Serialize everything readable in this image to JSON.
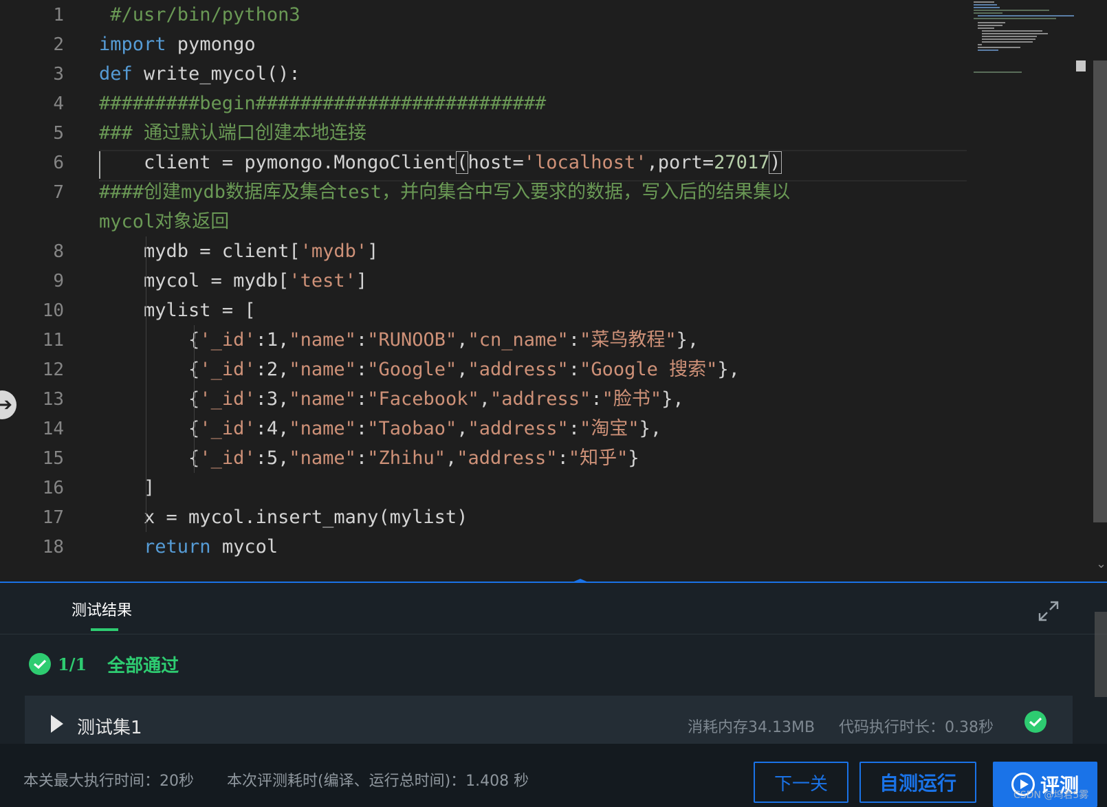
{
  "editor": {
    "line_numbers": [
      "1",
      "2",
      "3",
      "4",
      "5",
      "6",
      "7",
      "",
      "8",
      "9",
      "10",
      "11",
      "12",
      "13",
      "14",
      "15",
      "16",
      "17",
      "18"
    ],
    "lines": [
      {
        "n": 0,
        "tokens": [
          [
            "cm",
            " #/usr/bin/python3"
          ]
        ]
      },
      {
        "n": 1,
        "tokens": [
          [
            "kw",
            "import"
          ],
          [
            "",
            " pymongo"
          ]
        ]
      },
      {
        "n": 2,
        "tokens": [
          [
            "kw",
            "def"
          ],
          [
            "",
            " write_mycol():"
          ]
        ]
      },
      {
        "n": 3,
        "tokens": [
          [
            "cm",
            "#########begin##########################"
          ]
        ]
      },
      {
        "n": 4,
        "tokens": [
          [
            "cm",
            "### 通过默认端口创建本地连接"
          ]
        ]
      },
      {
        "n": 5,
        "tokens": [
          [
            "",
            "    client = pymongo.MongoClient"
          ],
          [
            "br",
            "("
          ],
          [
            "",
            "host="
          ],
          [
            "st",
            "'localhost'"
          ],
          [
            "",
            ",port="
          ],
          [
            "nm",
            "27017"
          ],
          [
            "br",
            ")"
          ]
        ]
      },
      {
        "n": 6,
        "tokens": [
          [
            "cm",
            "####创建mydb数据库及集合test，并向集合中写入要求的数据，写入后的结果集以"
          ]
        ]
      },
      {
        "n": 7,
        "tokens": [
          [
            "cm",
            "mycol对象返回"
          ]
        ]
      },
      {
        "n": 8,
        "tokens": [
          [
            "",
            "    mydb = client["
          ],
          [
            "st",
            "'mydb'"
          ],
          [
            "",
            "]"
          ]
        ]
      },
      {
        "n": 9,
        "tokens": [
          [
            "",
            "    mycol = mydb["
          ],
          [
            "st",
            "'test'"
          ],
          [
            "",
            "]"
          ]
        ]
      },
      {
        "n": 10,
        "tokens": [
          [
            "",
            "    mylist = ["
          ]
        ]
      },
      {
        "n": 11,
        "tokens": [
          [
            "",
            "        {"
          ],
          [
            "st",
            "'_id'"
          ],
          [
            "",
            ":1,"
          ],
          [
            "st",
            "\"name\""
          ],
          [
            "",
            ":"
          ],
          [
            "st",
            "\"RUNOOB\""
          ],
          [
            "",
            ","
          ],
          [
            "st",
            "\"cn_name\""
          ],
          [
            "",
            ":"
          ],
          [
            "st",
            "\"菜鸟教程\""
          ],
          [
            "",
            "},"
          ]
        ]
      },
      {
        "n": 12,
        "tokens": [
          [
            "",
            "        {"
          ],
          [
            "st",
            "'_id'"
          ],
          [
            "",
            ":2,"
          ],
          [
            "st",
            "\"name\""
          ],
          [
            "",
            ":"
          ],
          [
            "st",
            "\"Google\""
          ],
          [
            "",
            ","
          ],
          [
            "st",
            "\"address\""
          ],
          [
            "",
            ":"
          ],
          [
            "st",
            "\"Google 搜索\""
          ],
          [
            "",
            "},"
          ]
        ]
      },
      {
        "n": 13,
        "tokens": [
          [
            "",
            "        {"
          ],
          [
            "st",
            "'_id'"
          ],
          [
            "",
            ":3,"
          ],
          [
            "st",
            "\"name\""
          ],
          [
            "",
            ":"
          ],
          [
            "st",
            "\"Facebook\""
          ],
          [
            "",
            ","
          ],
          [
            "st",
            "\"address\""
          ],
          [
            "",
            ":"
          ],
          [
            "st",
            "\"脸书\""
          ],
          [
            "",
            "},"
          ]
        ]
      },
      {
        "n": 14,
        "tokens": [
          [
            "",
            "        {"
          ],
          [
            "st",
            "'_id'"
          ],
          [
            "",
            ":4,"
          ],
          [
            "st",
            "\"name\""
          ],
          [
            "",
            ":"
          ],
          [
            "st",
            "\"Taobao\""
          ],
          [
            "",
            ","
          ],
          [
            "st",
            "\"address\""
          ],
          [
            "",
            ":"
          ],
          [
            "st",
            "\"淘宝\""
          ],
          [
            "",
            "},"
          ]
        ]
      },
      {
        "n": 15,
        "tokens": [
          [
            "",
            "        {"
          ],
          [
            "st",
            "'_id'"
          ],
          [
            "",
            ":5,"
          ],
          [
            "st",
            "\"name\""
          ],
          [
            "",
            ":"
          ],
          [
            "st",
            "\"Zhihu\""
          ],
          [
            "",
            ","
          ],
          [
            "st",
            "\"address\""
          ],
          [
            "",
            ":"
          ],
          [
            "st",
            "\"知乎\""
          ],
          [
            "",
            "}"
          ]
        ]
      },
      {
        "n": 16,
        "tokens": [
          [
            "",
            "    ]"
          ]
        ]
      },
      {
        "n": 17,
        "tokens": [
          [
            "",
            "    x = mycol.insert_many(mylist)"
          ]
        ]
      },
      {
        "n": 18,
        "tokens": [
          [
            "kw",
            "    return"
          ],
          [
            "",
            " mycol"
          ]
        ]
      }
    ]
  },
  "results": {
    "tab_label": "测试结果",
    "pass_count": "1/1",
    "pass_text": "全部通过",
    "testset": {
      "name": "测试集1",
      "memory": "消耗内存34.13MB",
      "time": "代码执行时长：0.38秒"
    }
  },
  "footer": {
    "max_time": "本关最大执行时间：20秒",
    "eval_cost": "本次评测耗时(编译、运行总时间)：1.408 秒",
    "next_label": "下一关",
    "run_label": "自测运行",
    "eval_label": "评测"
  },
  "watermark": "CSDN @坞君5雾",
  "colors": {
    "accent": "#1a73e8",
    "success": "#2ecc71",
    "editor_bg": "#1e1e1e"
  },
  "icons": {
    "check": "check-circle-icon",
    "expand": "expand-icon",
    "play": "play-circle-icon",
    "caret": "caret-right-icon"
  }
}
